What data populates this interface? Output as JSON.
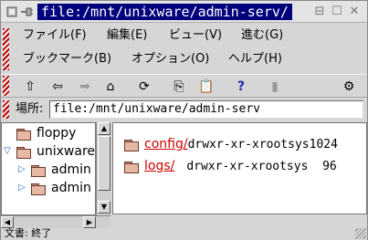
{
  "window": {
    "title": "file:/mnt/unixware/admin-serv/"
  },
  "menu": {
    "row1": [
      "ファイル(F)",
      "編集(E)",
      "ビュー(V)",
      "進む(G)"
    ],
    "row2": [
      "ブックマーク(B)",
      "オプション(O)",
      "ヘルプ(H)"
    ]
  },
  "toolbar": {
    "icons": [
      "up-arrow-icon",
      "back-arrow-icon",
      "forward-arrow-icon",
      "home-icon",
      "reload-icon",
      "copy-icon",
      "paste-icon",
      "help-icon",
      "settings-gear-icon"
    ]
  },
  "location": {
    "label": "場所:",
    "value": "file:/mnt/unixware/admin-serv"
  },
  "tree": {
    "items": [
      {
        "label": "floppy"
      },
      {
        "label": "unixware"
      },
      {
        "label": "admin"
      },
      {
        "label": "admin"
      }
    ]
  },
  "files": [
    {
      "name": "config/",
      "meta": "drwxr-xr-xrootsys1024"
    },
    {
      "name": "logs/",
      "meta": "drwxr-xr-xrootsys  96"
    }
  ],
  "status": {
    "text": "文書: 終了"
  }
}
